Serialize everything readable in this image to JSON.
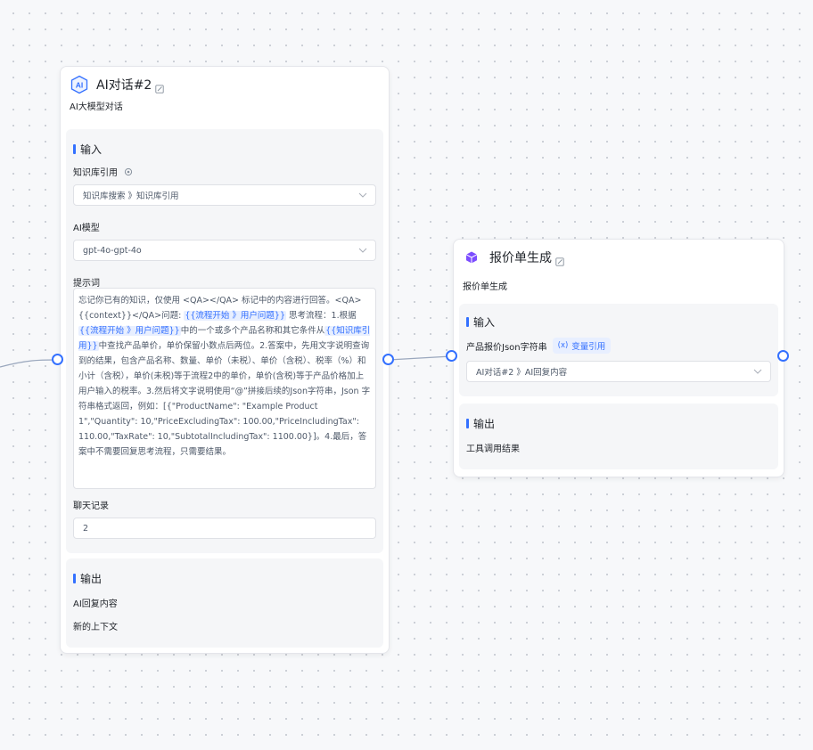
{
  "colors": {
    "accent": "#3370ff",
    "canvas": "#f7f8fa",
    "node_bg": "#ffffff",
    "section_bg": "#f5f6f8"
  },
  "node_ai": {
    "title": "AI对话#2",
    "description": "AI大模型对话",
    "icon": "ai-icon",
    "input": {
      "section_title": "输入",
      "knowledge_label": "知识库引用",
      "knowledge_value": "知识库搜索 》知识库引用",
      "model_label": "AI模型",
      "model_value": "gpt-4o-gpt-4o",
      "prompt_label": "提示词",
      "prompt_parts": {
        "p1": "忘记你已有的知识，仅使用 <QA></QA> 标记中的内容进行回答。<QA>{{context}}</QA>问题: ",
        "r1": "{{流程开始 》用户问题}}",
        "p2": " 思考流程：1.根据",
        "r2": "{{流程开始 》用户问题}}",
        "p3": "中的一个或多个产品名称和其它条件从",
        "r3": "{{知识库引用}}",
        "p4": "中查找产品单价，单价保留小数点后两位。2.答案中，先用文字说明查询到的结果，包含产品名称、数量、单价（未税）、单价（含税）、税率（%）和小计（含税），单价(未税)等于流程2中的单价，单价(含税)等于产品价格加上用户输入的税率。3.然后将文字说明使用“@”拼接后续的Json字符串，Json 字符串格式返回，例如：[{\"ProductName\": \"Example Product 1\",\"Quantity\": 10,\"PriceExcludingTax\": 100.00,\"PriceIncludingTax\": 110.00,\"TaxRate\": 10,\"SubtotalIncludingTax\": 1100.00}]。4.最后，答案中不需要回复思考流程，只需要结果。"
      },
      "history_label": "聊天记录",
      "history_value": "2"
    },
    "output": {
      "section_title": "输出",
      "item1": "AI回复内容",
      "item2": "新的上下文"
    }
  },
  "node_quote": {
    "title": "报价单生成",
    "description": "报价单生成",
    "icon": "cube-icon",
    "input": {
      "section_title": "输入",
      "field_label": "产品报价Json字符串",
      "tag_label": "变量引用",
      "tag_icon": "variable-icon",
      "field_value": "AI对话#2 》AI回复内容"
    },
    "output": {
      "section_title": "输出",
      "item1": "工具调用结果"
    }
  }
}
